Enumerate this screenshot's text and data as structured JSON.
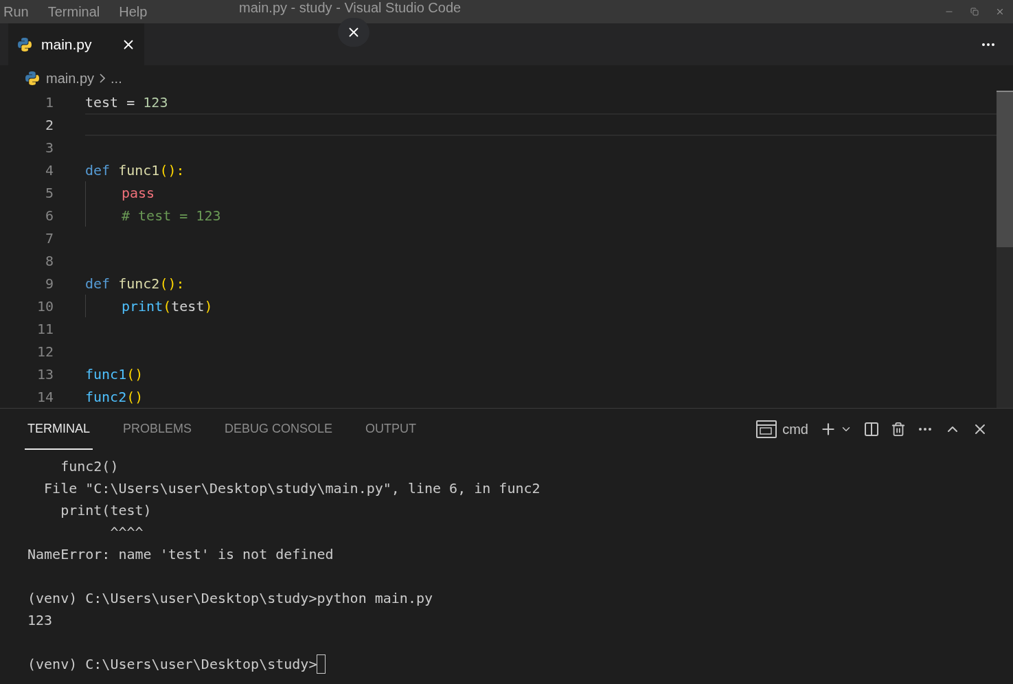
{
  "menu": [
    "Run",
    "Terminal",
    "Help"
  ],
  "window": {
    "title": "main.py - study - Visual Studio Code"
  },
  "tabs": [
    {
      "label": "main.py",
      "selected": true
    }
  ],
  "breadcrumb": [
    "main.py",
    "..."
  ],
  "code_lines": [
    {
      "number": "1",
      "current": false,
      "indent": false,
      "tokens": [
        {
          "kind": "plain",
          "text": "test = "
        },
        {
          "kind": "number",
          "text": "123"
        }
      ]
    },
    {
      "number": "2",
      "current": true,
      "indent": false
    },
    {
      "number": "3",
      "current": false,
      "indent": false
    },
    {
      "number": "4",
      "current": false,
      "indent": false,
      "tokens": [
        {
          "kind": "keyword",
          "text": "def "
        },
        {
          "kind": "function",
          "text": "func1"
        },
        {
          "kind": "paren",
          "text": "():"
        }
      ]
    },
    {
      "number": "5",
      "current": false,
      "indent": true,
      "tokens": [
        {
          "kind": "control",
          "text": "pass"
        }
      ]
    },
    {
      "number": "6",
      "current": false,
      "indent": true,
      "tokens": [
        {
          "kind": "comment",
          "text": "# test = 123"
        }
      ]
    },
    {
      "number": "7",
      "current": false,
      "indent": false
    },
    {
      "number": "8",
      "current": false,
      "indent": false
    },
    {
      "number": "9",
      "current": false,
      "indent": false,
      "tokens": [
        {
          "kind": "keyword",
          "text": "def "
        },
        {
          "kind": "function",
          "text": "func2"
        },
        {
          "kind": "paren",
          "text": "():"
        }
      ]
    },
    {
      "number": "10",
      "current": false,
      "indent": true,
      "tokens": [
        {
          "kind": "call",
          "text": "print"
        },
        {
          "kind": "paren",
          "text": "("
        },
        {
          "kind": "plain",
          "text": "test"
        },
        {
          "kind": "paren",
          "text": ")"
        }
      ]
    },
    {
      "number": "11",
      "current": false,
      "indent": false
    },
    {
      "number": "12",
      "current": false,
      "indent": false
    },
    {
      "number": "13",
      "current": false,
      "indent": false,
      "tokens": [
        {
          "kind": "call",
          "text": "func1"
        },
        {
          "kind": "paren",
          "text": "()"
        }
      ]
    },
    {
      "number": "14",
      "current": false,
      "indent": false,
      "tokens": [
        {
          "kind": "call",
          "text": "func2"
        },
        {
          "kind": "paren",
          "text": "()"
        }
      ]
    }
  ],
  "panel_tabs": [
    {
      "label": "TERMINAL",
      "selected": true
    },
    {
      "label": "PROBLEMS",
      "selected": false
    },
    {
      "label": "DEBUG CONSOLE",
      "selected": false
    },
    {
      "label": "OUTPUT",
      "selected": false
    }
  ],
  "terminal_shell": "cmd",
  "terminal_lines": [
    {
      "text": "    func2()",
      "cursor": false
    },
    {
      "text": "  File \"C:\\Users\\user\\Desktop\\study\\main.py\", line 6, in func2",
      "cursor": false
    },
    {
      "text": "    print(test)",
      "cursor": false
    },
    {
      "text": "          ^^^^",
      "cursor": false
    },
    {
      "text": "NameError: name 'test' is not defined",
      "cursor": false
    },
    {
      "cursor": false
    },
    {
      "text": "(venv) C:\\Users\\user\\Desktop\\study>python main.py",
      "cursor": false
    },
    {
      "text": "123",
      "cursor": false
    },
    {
      "cursor": false
    },
    {
      "text": "(venv) C:\\Users\\user\\Desktop\\study>",
      "cursor": true
    }
  ]
}
